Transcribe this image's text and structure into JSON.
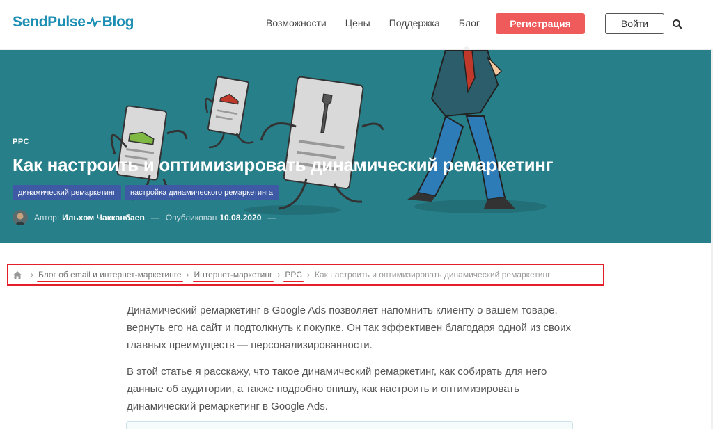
{
  "header": {
    "logo_left": "SendPulse",
    "logo_right": "Blog",
    "nav": [
      "Возможности",
      "Цены",
      "Поддержка",
      "Блог"
    ],
    "register_label": "Регистрация",
    "login_label": "Войти",
    "search_icon": "search-icon"
  },
  "hero": {
    "category": "PPC",
    "title": "Как настроить и оптимизировать динамический ремаркетинг",
    "tags": [
      "динамический ремаркетинг",
      "настройка динамического ремаркетинга"
    ],
    "author_label": "Автор:",
    "author_name": "Ильхом Чакканбаев",
    "published_label": "Опубликован",
    "published_date": "10.08.2020",
    "dash": "—"
  },
  "breadcrumb": {
    "home_icon": "home-icon",
    "items": [
      "Блог об email и интернет-маркетинге",
      "Интернет-маркетинг",
      "PPC"
    ],
    "current": "Как настроить и оптимизировать динамический ремаркетинг",
    "separator": "›"
  },
  "article": {
    "paragraphs": [
      "Динамический ремаркетинг в Google Ads позволяет напомнить клиенту о вашем товаре, вернуть его на сайт и подтолкнуть к покупке. Он так эффективен благодаря одной из своих главных преимуществ — персонализированности.",
      "В этой статье я расскажу, что такое динамический ремаркетинг, как собирать для него данные об аудитории, а также подробно опишу, как настроить и оптимизировать динамический ремаркетинг в Google Ads."
    ]
  },
  "colors": {
    "brand": "#1d8fb4",
    "hero_bg": "#277f8a",
    "register": "#ef5a5a",
    "tag": "#3e5aa5",
    "highlight": "#e3202a"
  }
}
